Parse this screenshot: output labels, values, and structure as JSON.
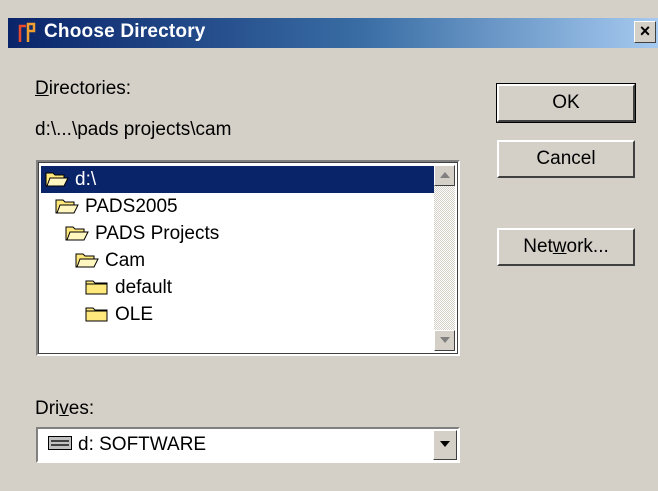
{
  "window": {
    "title": "Choose Directory",
    "close_label": "×"
  },
  "directories": {
    "label_prefix": "",
    "label_accel": "D",
    "label_rest": "irectories:",
    "current_path": "d:\\...\\pads projects\\cam",
    "items": [
      {
        "name": "d:\\",
        "icon": "open-folder-icon",
        "indent": 0,
        "selected": true
      },
      {
        "name": "PADS2005",
        "icon": "open-folder-icon",
        "indent": 1
      },
      {
        "name": "PADS Projects",
        "icon": "open-folder-icon",
        "indent": 2
      },
      {
        "name": "Cam",
        "icon": "open-folder-icon",
        "indent": 3
      },
      {
        "name": "default",
        "icon": "closed-folder-icon",
        "indent": 4
      },
      {
        "name": "OLE",
        "icon": "closed-folder-icon",
        "indent": 4
      }
    ]
  },
  "buttons": {
    "ok": "OK",
    "cancel": "Cancel",
    "network_prefix": "Net",
    "network_accel": "w",
    "network_rest": "ork..."
  },
  "drives": {
    "label_prefix": "Dri",
    "label_accel": "v",
    "label_rest": "es:",
    "selected": "d: SOFTWARE",
    "icon": "drive-icon"
  },
  "colors": {
    "face": "#d4d0c8",
    "title_start": "#0a246a",
    "title_end": "#a6caf0",
    "selection": "#0a246a",
    "folder_fill": "#ffe87c"
  }
}
